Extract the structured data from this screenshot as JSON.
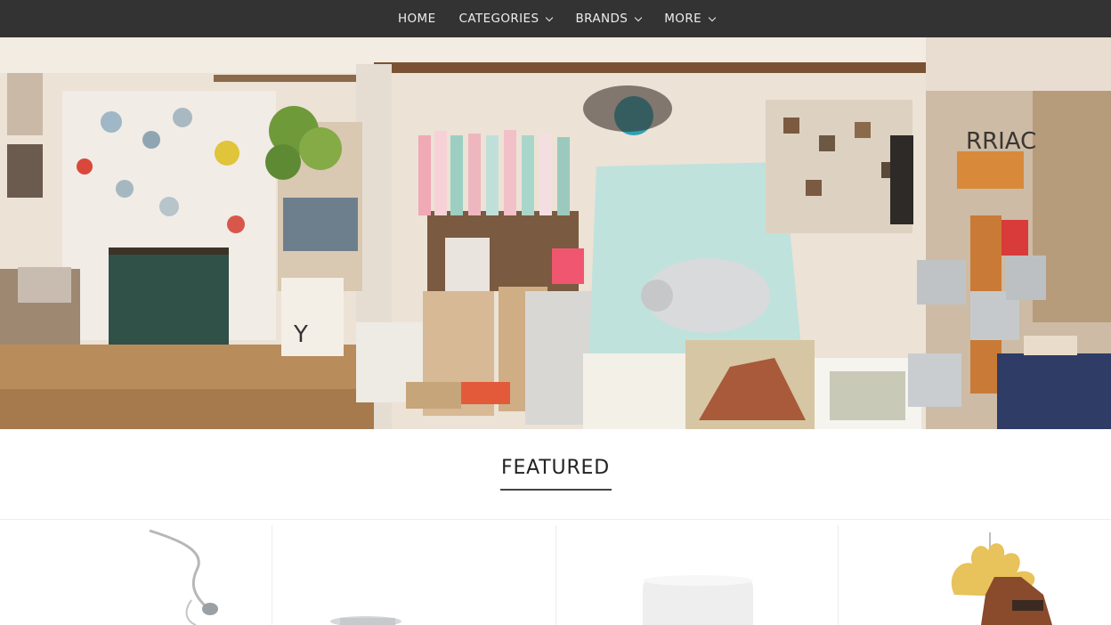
{
  "nav": {
    "items": [
      {
        "label": "HOME",
        "has_dropdown": false
      },
      {
        "label": "CATEGORIES",
        "has_dropdown": true
      },
      {
        "label": "BRANDS",
        "has_dropdown": true
      },
      {
        "label": "MORE",
        "has_dropdown": true
      }
    ]
  },
  "hero": {
    "sign_text": "RRIAC"
  },
  "featured": {
    "title": "FEATURED"
  },
  "products": [
    {
      "image": "hanging-metal-ornament"
    },
    {
      "image": "silver-dish"
    },
    {
      "image": "white-candle"
    },
    {
      "image": "wooden-moose-ornament"
    }
  ],
  "colors": {
    "nav_bg": "#333333",
    "nav_text": "#ededed",
    "heading_text": "#222222"
  }
}
